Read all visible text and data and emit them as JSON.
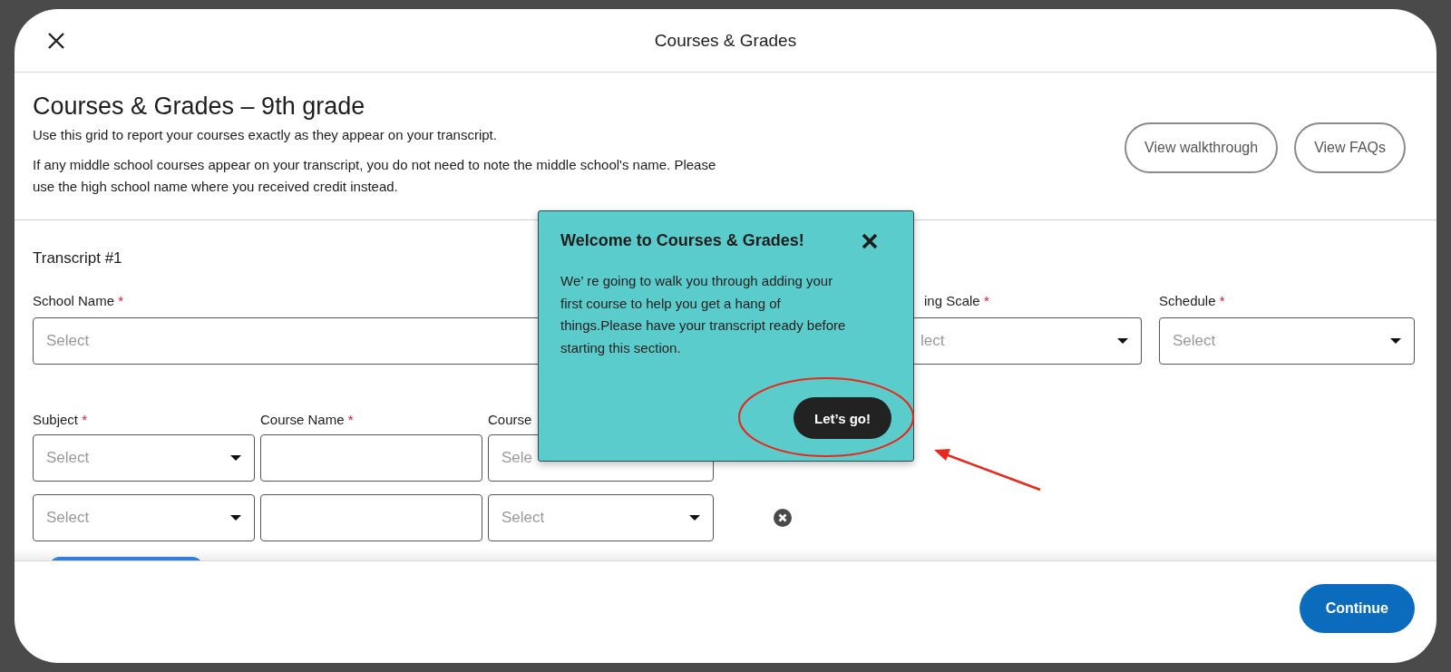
{
  "dialog": {
    "title": "Courses & Grades"
  },
  "intro": {
    "heading": "Courses & Grades – 9th grade",
    "paragraphs": [
      "Use this grid to report your courses exactly as they appear on your transcript.",
      "If any middle school courses appear on your transcript, you do not need to note the middle school's name. Please use the high school name where you received credit instead."
    ],
    "buttons": [
      "View walkthrough",
      "View FAQs"
    ]
  },
  "transcript": {
    "title": "Transcript #1",
    "fields": [
      {
        "label": "School Name",
        "mark": "*",
        "kind": "text",
        "placeholder": "Select"
      },
      {
        "label": "ing Scale",
        "mark": "*",
        "kind": "select",
        "placeholder": "lect"
      },
      {
        "label": "Schedule",
        "mark": "*",
        "kind": "select",
        "placeholder": "Select"
      }
    ]
  },
  "courses": {
    "headers": [
      {
        "label": "Subject",
        "mark": "*"
      },
      {
        "label": "Course Name",
        "mark": "*"
      },
      {
        "label": "Course"
      }
    ],
    "rows": [
      {
        "removable": false,
        "cells": [
          {
            "kind": "select",
            "placeholder": "Select"
          },
          {
            "kind": "text"
          },
          {
            "kind": "text",
            "placeholder": "Sele"
          }
        ]
      },
      {
        "removable": true,
        "cells": [
          {
            "kind": "select",
            "placeholder": "Select"
          },
          {
            "kind": "text"
          },
          {
            "kind": "select",
            "placeholder": "Select"
          }
        ]
      }
    ]
  },
  "popup": {
    "title": "Welcome to Courses & Grades!",
    "body": "We’ re going to walk you through adding your first course to help you get a hang of things.Please have your transcript ready before starting this section.",
    "button": "Let’s go!"
  },
  "footer": {
    "button": "Continue"
  }
}
